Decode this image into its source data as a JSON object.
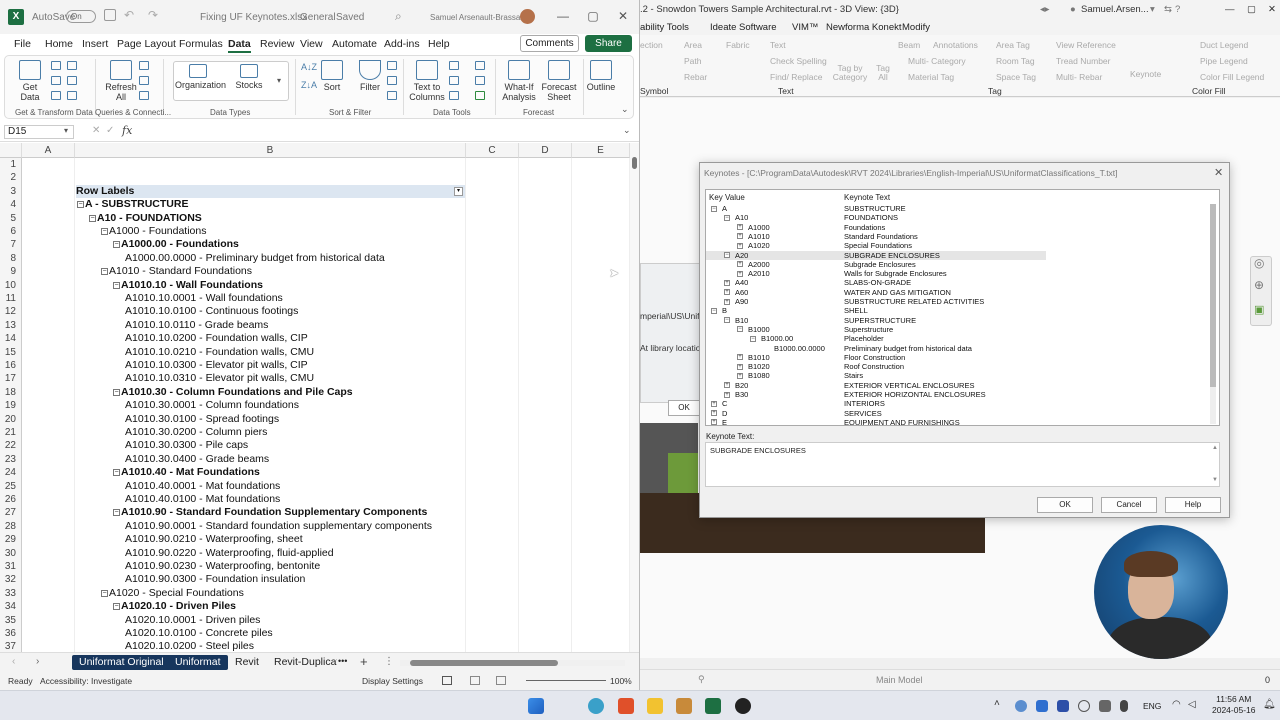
{
  "excel": {
    "autosave_label": "AutoSave",
    "autosave_state": "On",
    "filename": "Fixing UF Keynotes.xlsx",
    "sensitivity": "General",
    "saved": "Saved",
    "user": "Samuel Arsenault-Brassard",
    "menu": [
      "File",
      "Home",
      "Insert",
      "Page Layout",
      "Formulas",
      "Data",
      "Review",
      "View",
      "Automate",
      "Add-ins",
      "Help"
    ],
    "active_menu": "Data",
    "comments": "Comments",
    "share": "Share",
    "ribbon": {
      "get_data": "Get\nData",
      "refresh_all": "Refresh\nAll",
      "organization": "Organization",
      "stocks": "Stocks",
      "sort": "Sort",
      "filter": "Filter",
      "text_to_columns": "Text to\nColumns",
      "what_if": "What-If\nAnalysis",
      "forecast_sheet": "Forecast\nSheet",
      "outline": "Outline",
      "groups": [
        "Get & Transform Data",
        "Queries & Connecti...",
        "Data Types",
        "Sort & Filter",
        "Data Tools",
        "Forecast"
      ]
    },
    "name_box": "D15",
    "fx": "fx",
    "columns": [
      "A",
      "B",
      "C",
      "D",
      "E"
    ],
    "rows": [
      {
        "n": "1",
        "t": "",
        "lvl": 0,
        "b": false,
        "pm": ""
      },
      {
        "n": "2",
        "t": "",
        "lvl": 0,
        "b": false,
        "pm": ""
      },
      {
        "n": "3",
        "t": "Row Labels",
        "lvl": 0,
        "b": true,
        "pm": "",
        "hdr": true
      },
      {
        "n": "4",
        "t": "A - SUBSTRUCTURE",
        "lvl": 0,
        "b": true,
        "pm": "-"
      },
      {
        "n": "5",
        "t": "A10 - FOUNDATIONS",
        "lvl": 1,
        "b": true,
        "pm": "-"
      },
      {
        "n": "6",
        "t": "A1000 - Foundations",
        "lvl": 2,
        "b": false,
        "pm": "-"
      },
      {
        "n": "7",
        "t": "A1000.00 - Foundations",
        "lvl": 3,
        "b": true,
        "pm": "-"
      },
      {
        "n": "8",
        "t": "A1000.00.0000 - Preliminary budget from historical data",
        "lvl": 4,
        "b": false,
        "pm": ""
      },
      {
        "n": "9",
        "t": "A1010 - Standard Foundations",
        "lvl": 2,
        "b": false,
        "pm": "-"
      },
      {
        "n": "10",
        "t": "A1010.10 - Wall Foundations",
        "lvl": 3,
        "b": true,
        "pm": "-"
      },
      {
        "n": "11",
        "t": "A1010.10.0001 - Wall foundations",
        "lvl": 4,
        "b": false,
        "pm": ""
      },
      {
        "n": "12",
        "t": "A1010.10.0100 - Continuous footings",
        "lvl": 4,
        "b": false,
        "pm": ""
      },
      {
        "n": "13",
        "t": "A1010.10.0110 - Grade beams",
        "lvl": 4,
        "b": false,
        "pm": ""
      },
      {
        "n": "14",
        "t": "A1010.10.0200 - Foundation walls, CIP",
        "lvl": 4,
        "b": false,
        "pm": ""
      },
      {
        "n": "15",
        "t": "A1010.10.0210 - Foundation walls, CMU",
        "lvl": 4,
        "b": false,
        "pm": ""
      },
      {
        "n": "16",
        "t": "A1010.10.0300 - Elevator pit walls, CIP",
        "lvl": 4,
        "b": false,
        "pm": ""
      },
      {
        "n": "17",
        "t": "A1010.10.0310 - Elevator pit walls, CMU",
        "lvl": 4,
        "b": false,
        "pm": ""
      },
      {
        "n": "18",
        "t": "A1010.30 - Column Foundations and Pile Caps",
        "lvl": 3,
        "b": true,
        "pm": "-"
      },
      {
        "n": "19",
        "t": "A1010.30.0001 - Column foundations",
        "lvl": 4,
        "b": false,
        "pm": ""
      },
      {
        "n": "20",
        "t": "A1010.30.0100 - Spread footings",
        "lvl": 4,
        "b": false,
        "pm": ""
      },
      {
        "n": "21",
        "t": "A1010.30.0200 - Column piers",
        "lvl": 4,
        "b": false,
        "pm": ""
      },
      {
        "n": "22",
        "t": "A1010.30.0300 - Pile caps",
        "lvl": 4,
        "b": false,
        "pm": ""
      },
      {
        "n": "23",
        "t": "A1010.30.0400 - Grade beams",
        "lvl": 4,
        "b": false,
        "pm": ""
      },
      {
        "n": "24",
        "t": "A1010.40 - Mat Foundations",
        "lvl": 3,
        "b": true,
        "pm": "-"
      },
      {
        "n": "25",
        "t": "A1010.40.0001 - Mat foundations",
        "lvl": 4,
        "b": false,
        "pm": ""
      },
      {
        "n": "26",
        "t": "A1010.40.0100 - Mat foundations",
        "lvl": 4,
        "b": false,
        "pm": ""
      },
      {
        "n": "27",
        "t": "A1010.90 - Standard Foundation Supplementary Components",
        "lvl": 3,
        "b": true,
        "pm": "-"
      },
      {
        "n": "28",
        "t": "A1010.90.0001 - Standard foundation supplementary components",
        "lvl": 4,
        "b": false,
        "pm": ""
      },
      {
        "n": "29",
        "t": "A1010.90.0210 - Waterproofing, sheet",
        "lvl": 4,
        "b": false,
        "pm": ""
      },
      {
        "n": "30",
        "t": "A1010.90.0220 - Waterproofing, fluid-applied",
        "lvl": 4,
        "b": false,
        "pm": ""
      },
      {
        "n": "31",
        "t": "A1010.90.0230 - Waterproofing, bentonite",
        "lvl": 4,
        "b": false,
        "pm": ""
      },
      {
        "n": "32",
        "t": "A1010.90.0300 - Foundation insulation",
        "lvl": 4,
        "b": false,
        "pm": ""
      },
      {
        "n": "33",
        "t": "A1020 - Special Foundations",
        "lvl": 2,
        "b": false,
        "pm": "-"
      },
      {
        "n": "34",
        "t": "A1020.10 - Driven Piles",
        "lvl": 3,
        "b": true,
        "pm": "-"
      },
      {
        "n": "35",
        "t": "A1020.10.0001 - Driven piles",
        "lvl": 4,
        "b": false,
        "pm": ""
      },
      {
        "n": "36",
        "t": "A1020.10.0100 - Concrete piles",
        "lvl": 4,
        "b": false,
        "pm": ""
      },
      {
        "n": "37",
        "t": "A1020.10.0200 - Steel piles",
        "lvl": 4,
        "b": false,
        "pm": ""
      }
    ],
    "sheet_tabs": [
      "Uniformat Original",
      "Uniformat",
      "Revit",
      "Revit-Duplicat"
    ],
    "tab_more": "•••",
    "status": {
      "ready": "Ready",
      "accessibility": "Accessibility: Investigate",
      "display": "Display Settings",
      "zoom": "100%"
    }
  },
  "revit": {
    "title": ".2 - Snowdon Towers Sample Architectural.rvt - 3D View: {3D}",
    "user": "Samuel.Arsen...",
    "tabs": [
      "ability Tools",
      "Ideate Software",
      "VIM™",
      "Newforma Konekt",
      "Modify"
    ],
    "ribbon_items": [
      "ection",
      "Area",
      "Fabric",
      "Path",
      "Rebar",
      "Text",
      "Check Spelling",
      "Find/ Replace",
      "Beam",
      "Tag by Category",
      "Tag All",
      "Annotations",
      "Multi- Category",
      "Material Tag",
      "Area Tag",
      "Room Tag",
      "Space Tag",
      "View Reference",
      "Tread Number",
      "Multi- Rebar",
      "Keynote",
      "Duct Legend",
      "Pipe Legend",
      "Color Fill Legend"
    ],
    "ribbon_groups": [
      "Symbol",
      "Text",
      "Tag",
      "Color Fill"
    ],
    "ghost": {
      "path": "mperial\\US\\Uniform",
      "library": "At library location",
      "ok": "OK"
    },
    "status_model": "Main Model",
    "status_zero": "0"
  },
  "dialog": {
    "title": "Keynotes - [C:\\ProgramData\\Autodesk\\RVT 2024\\Libraries\\English-Imperial\\US\\UniformatClassifications_T.txt]",
    "col_key": "Key Value",
    "col_text": "Keynote Text",
    "rows": [
      {
        "k": "A",
        "t": "SUBSTRUCTURE",
        "d": 0,
        "pm": "-"
      },
      {
        "k": "A10",
        "t": "FOUNDATIONS",
        "d": 1,
        "pm": "-"
      },
      {
        "k": "A1000",
        "t": "Foundations",
        "d": 2,
        "pm": "+"
      },
      {
        "k": "A1010",
        "t": "Standard Foundations",
        "d": 2,
        "pm": "+"
      },
      {
        "k": "A1020",
        "t": "Special Foundations",
        "d": 2,
        "pm": "+"
      },
      {
        "k": "A20",
        "t": "SUBGRADE ENCLOSURES",
        "d": 1,
        "pm": "-",
        "sel": true
      },
      {
        "k": "A2000",
        "t": "Subgrade Enclosures",
        "d": 2,
        "pm": "+"
      },
      {
        "k": "A2010",
        "t": "Walls for Subgrade Enclosures",
        "d": 2,
        "pm": "+"
      },
      {
        "k": "A40",
        "t": "SLABS-ON-GRADE",
        "d": 1,
        "pm": "+"
      },
      {
        "k": "A60",
        "t": "WATER AND GAS MITIGATION",
        "d": 1,
        "pm": "+"
      },
      {
        "k": "A90",
        "t": "SUBSTRUCTURE RELATED ACTIVITIES",
        "d": 1,
        "pm": "+"
      },
      {
        "k": "B",
        "t": "SHELL",
        "d": 0,
        "pm": "-"
      },
      {
        "k": "B10",
        "t": "SUPERSTRUCTURE",
        "d": 1,
        "pm": "-"
      },
      {
        "k": "B1000",
        "t": "Superstructure",
        "d": 2,
        "pm": "-"
      },
      {
        "k": "B1000.00",
        "t": "Placeholder",
        "d": 3,
        "pm": "-"
      },
      {
        "k": "B1000.00.0000",
        "t": "Preliminary budget from historical data",
        "d": 4,
        "pm": ""
      },
      {
        "k": "B1010",
        "t": "Floor Construction",
        "d": 2,
        "pm": "+"
      },
      {
        "k": "B1020",
        "t": "Roof Construction",
        "d": 2,
        "pm": "+"
      },
      {
        "k": "B1080",
        "t": "Stairs",
        "d": 2,
        "pm": "+"
      },
      {
        "k": "B20",
        "t": "EXTERIOR VERTICAL ENCLOSURES",
        "d": 1,
        "pm": "+"
      },
      {
        "k": "B30",
        "t": "EXTERIOR HORIZONTAL ENCLOSURES",
        "d": 1,
        "pm": "+"
      },
      {
        "k": "C",
        "t": "INTERIORS",
        "d": 0,
        "pm": "+"
      },
      {
        "k": "D",
        "t": "SERVICES",
        "d": 0,
        "pm": "+"
      },
      {
        "k": "E",
        "t": "EQUIPMENT AND FURNISHINGS",
        "d": 0,
        "pm": "+"
      }
    ],
    "keynote_text_label": "Keynote Text:",
    "keynote_text": "SUBGRADE ENCLOSURES",
    "ok": "OK",
    "cancel": "Cancel",
    "help": "Help"
  },
  "taskbar": {
    "lang": "ENG",
    "time": "11:56 AM",
    "date": "2024-05-16"
  },
  "colors": {
    "excel_green": "#1d6f42",
    "tab_navy": "#17365d"
  }
}
